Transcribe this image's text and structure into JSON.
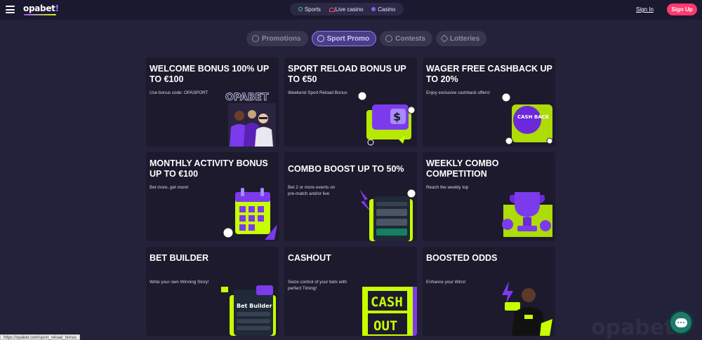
{
  "header": {
    "logo_text": "opabet",
    "logo_bang": "!",
    "nav": [
      {
        "label": "Sports",
        "icon": "soccer-ball-icon"
      },
      {
        "label": "Live casino",
        "icon": "heart-icon"
      },
      {
        "label": "Casino",
        "icon": "club-icon"
      }
    ],
    "signin_label": "Sign In",
    "signup_label": "Sign Up"
  },
  "subtabs": [
    {
      "label": "Promotions",
      "icon": "gift-icon",
      "active": false
    },
    {
      "label": "Sport Promo",
      "icon": "soccer-ball-icon",
      "active": true
    },
    {
      "label": "Contests",
      "icon": "pin-icon",
      "active": false
    },
    {
      "label": "Lotteries",
      "icon": "ticket-icon",
      "active": false
    }
  ],
  "cards": [
    {
      "title": "WELCOME BONUS 100% UP TO €100",
      "text": "Use bonus code: OPASPORT",
      "art": "players-art"
    },
    {
      "title": "SPORT RELOAD BONUS UP TO €50",
      "text": "Weekend Sport Reload Bonus",
      "art": "wallet-art"
    },
    {
      "title": "WAGER FREE CASHBACK UP TO 20%",
      "text": "Enjoy exclusive cashback offers!",
      "art": "cashback-art"
    },
    {
      "title": "MONTHLY ACTIVITY BONUS UP TO €100",
      "text": "Bet more, get more!",
      "art": "calendar-art"
    },
    {
      "title": "COMBO BOOST UP TO 50%",
      "text": "Bet 2 or more events on pre-match and/or live",
      "art": "phone-art"
    },
    {
      "title": "WEEKLY COMBO COMPETITION",
      "text": "Reach the weekly top",
      "art": "trophy-art"
    },
    {
      "title": "BET BUILDER",
      "text": "Write your own Winning Story!",
      "art": "betbuilder-art"
    },
    {
      "title": "CASHOUT",
      "text": "Seize control of your bets with perfect Timing!",
      "art": "cashout-art"
    },
    {
      "title": "BOOSTED ODDS",
      "text": "Enhance your Wins!",
      "art": "player-art"
    }
  ],
  "art_text": {
    "opabet_sign": "OPABET",
    "cash_back": "CASH BACK",
    "bet_builder": "Bet Builder",
    "cash": "CASH",
    "out": "OUT"
  },
  "status_url": "https://opabet.com/sport_reload_bonus",
  "watermark": "opabet",
  "colors": {
    "accent": "#ff3a6e",
    "lime": "#c8ff00",
    "purple": "#8b5cf6",
    "bg": "#24213a",
    "card": "#1c1a2c"
  }
}
